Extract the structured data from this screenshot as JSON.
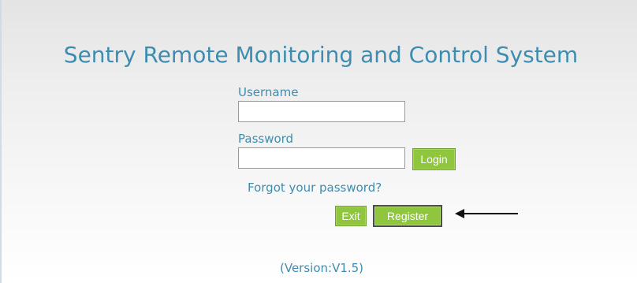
{
  "page": {
    "title": "Sentry Remote Monitoring and Control System",
    "version": "(Version:V1.5)"
  },
  "login_form": {
    "username_label": "Username",
    "username_value": "",
    "password_label": "Password",
    "password_value": "",
    "login_label": "Login",
    "forgot_password_label": "Forgot your password?"
  },
  "actions": {
    "exit_label": "Exit",
    "register_label": "Register"
  },
  "annotation": {
    "icon": "left-arrow-icon",
    "points_to": "Register"
  },
  "colors": {
    "text_accent": "#3e8db0",
    "button_green": "#8fc63e",
    "background_top": "#e4e4e4",
    "background_bottom": "#ffffff"
  }
}
